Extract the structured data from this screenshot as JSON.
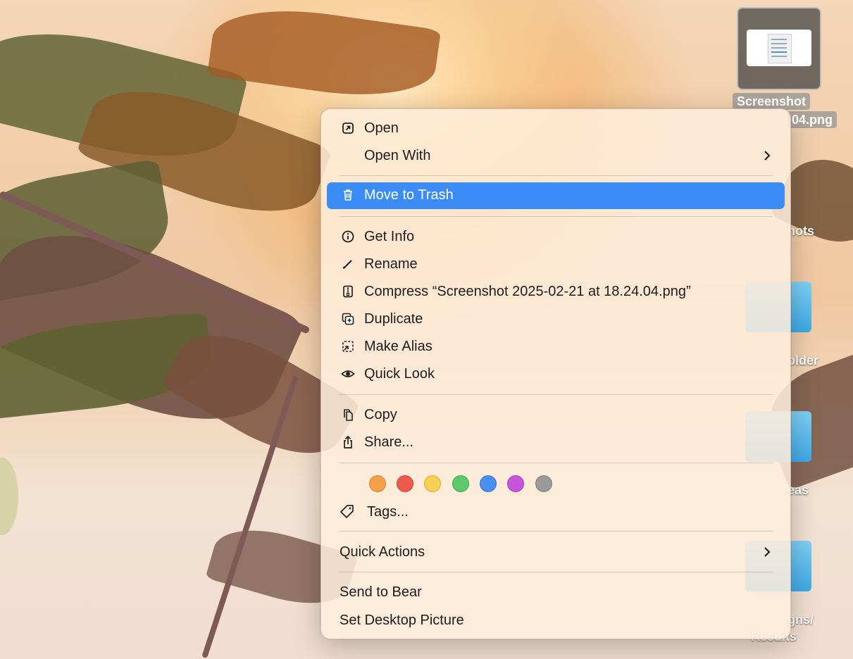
{
  "desktop": {
    "selected_file_label_line1": "Screenshot",
    "selected_file_label_line2": "04.png",
    "icon_labels": [
      "hots",
      "older",
      "eas",
      "gns/",
      "Results"
    ]
  },
  "menu": {
    "open": "Open",
    "open_with": "Open With",
    "move_to_trash": "Move to Trash",
    "get_info": "Get Info",
    "rename": "Rename",
    "compress": "Compress “Screenshot 2025-02-21 at 18.24.04.png”",
    "duplicate": "Duplicate",
    "make_alias": "Make Alias",
    "quick_look": "Quick Look",
    "copy": "Copy",
    "share": "Share...",
    "tags": "Tags...",
    "quick_actions": "Quick Actions",
    "send_to_bear": "Send to Bear",
    "set_desktop_picture": "Set Desktop Picture"
  },
  "tag_colors": [
    {
      "name": "orange",
      "hex": "#f5a04a"
    },
    {
      "name": "red",
      "hex": "#ee5b4c"
    },
    {
      "name": "yellow",
      "hex": "#f7cf52"
    },
    {
      "name": "green",
      "hex": "#5cc96a"
    },
    {
      "name": "blue",
      "hex": "#4a90f2"
    },
    {
      "name": "purple",
      "hex": "#c656d8"
    },
    {
      "name": "gray",
      "hex": "#9a9a9a"
    }
  ],
  "accent_color": "#3b8cf7"
}
